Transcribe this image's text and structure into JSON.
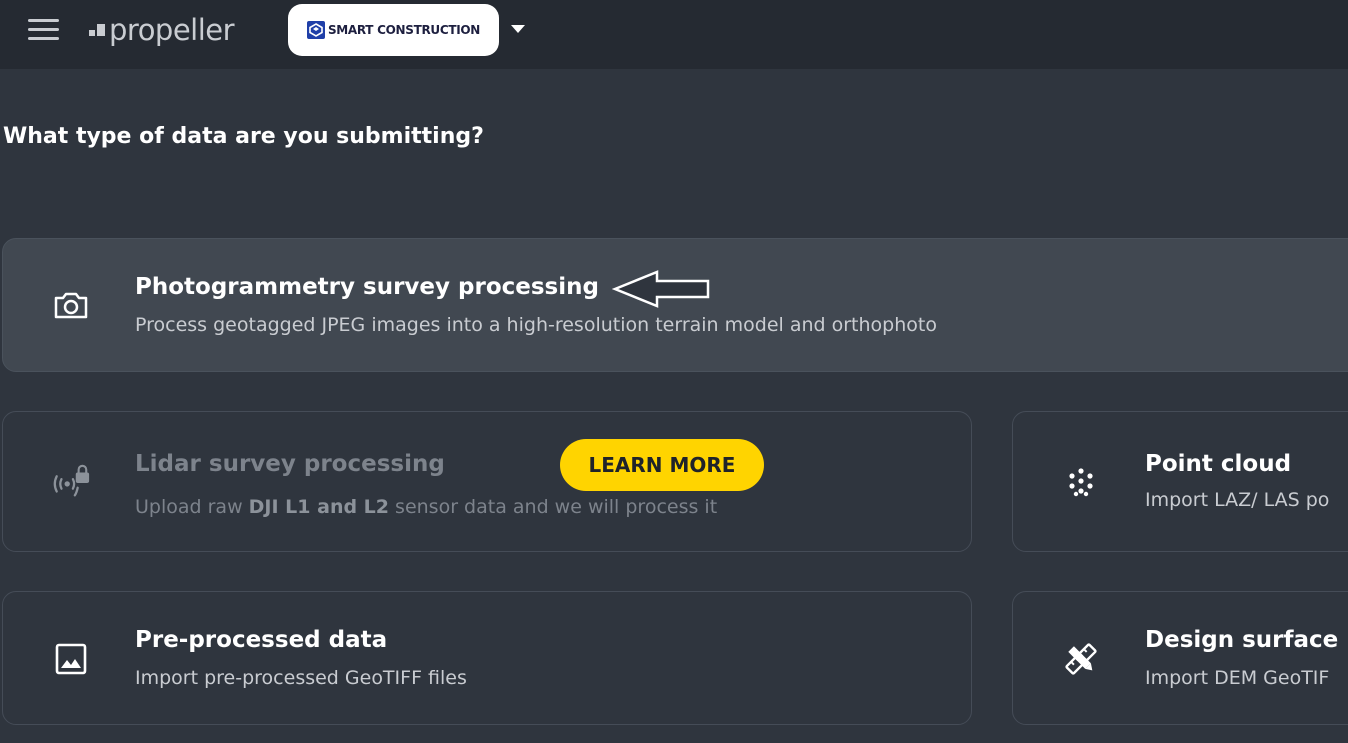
{
  "topbar": {
    "logo_text": "propeller",
    "org_name": "SMART CONSTRUCTION"
  },
  "page": {
    "heading": "What type of data are you submitting?"
  },
  "options": {
    "photogrammetry": {
      "title": "Photogrammetry survey processing",
      "description": "Process geotagged JPEG images into a high-resolution terrain model and orthophoto",
      "icon": "camera-icon"
    },
    "lidar": {
      "title": "Lidar survey processing",
      "description_prefix": "Upload raw ",
      "description_bold": "DJI L1 and L2",
      "description_suffix": " sensor data and we will process it",
      "icon": "lidar-locked-icon",
      "learn_more_label": "LEARN MORE"
    },
    "point_cloud": {
      "title": "Point cloud",
      "description": "Import LAZ/ LAS po",
      "icon": "point-cloud-icon"
    },
    "preprocessed": {
      "title": "Pre-processed data",
      "description": "Import pre-processed GeoTIFF files",
      "icon": "image-icon"
    },
    "design_surface": {
      "title": "Design surface",
      "description": "Import DEM GeoTIF",
      "icon": "design-tools-icon"
    }
  },
  "colors": {
    "background": "#2f353e",
    "topbar": "#252a32",
    "accent": "#ffd400",
    "active_card": "#414851"
  }
}
